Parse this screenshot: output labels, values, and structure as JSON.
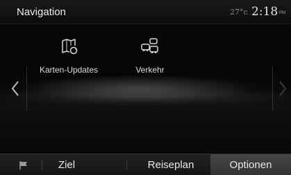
{
  "header": {
    "title": "Navigation",
    "temperature": "27°c",
    "time": "2:18",
    "ampm": "PM"
  },
  "tiles": [
    {
      "label": "Karten-Updates",
      "icon": "map-update-icon"
    },
    {
      "label": "Verkehr",
      "icon": "traffic-icon"
    }
  ],
  "nav": {
    "prev_icon": "chevron-left-icon",
    "next_icon": "chevron-right-icon"
  },
  "bottom_bar": {
    "flag_icon": "flag-icon",
    "tabs": [
      {
        "label": "Ziel"
      },
      {
        "label": "Reiseplan"
      },
      {
        "label": "Optionen",
        "active": true
      }
    ]
  },
  "colors": {
    "background": "#000000",
    "text": "#e6e6e6",
    "active_tab": "#3d3d3d"
  }
}
